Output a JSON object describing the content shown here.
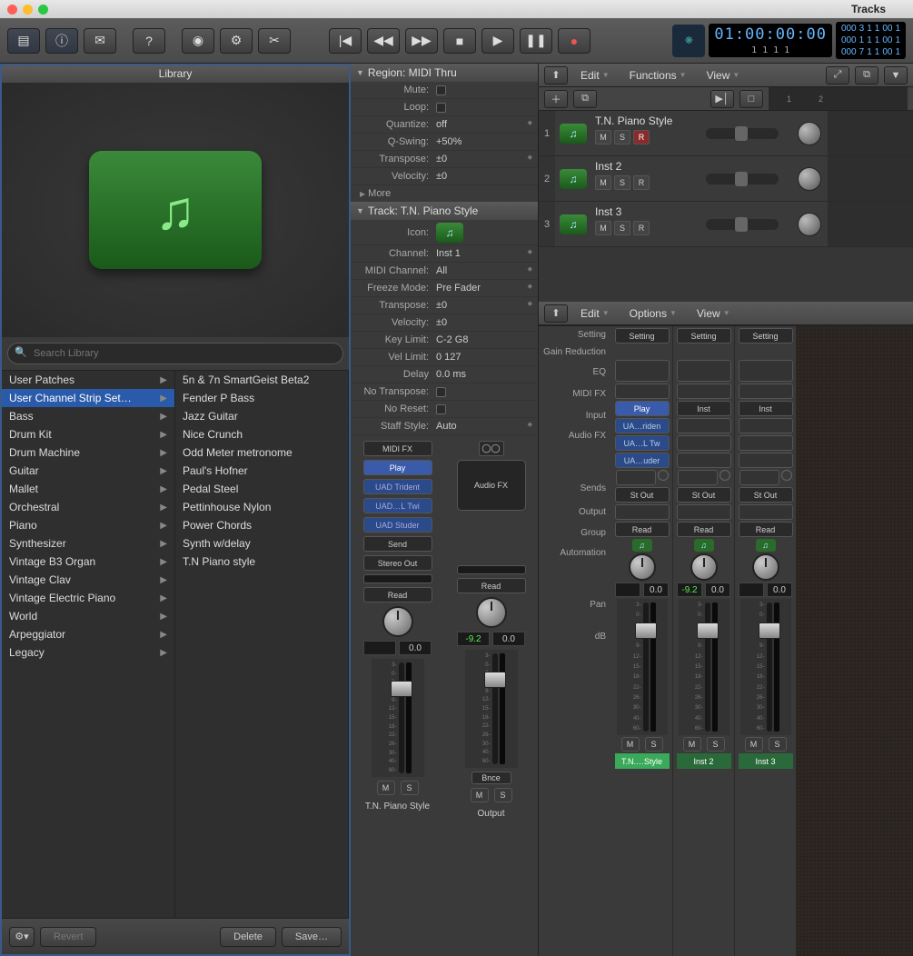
{
  "window": {
    "title": "Tracks"
  },
  "transport": {
    "timecode": "01:00:00:00",
    "timecode_sub": "1 1 1 1",
    "grid1": [
      "000",
      "3",
      "1",
      "1",
      "00",
      "1"
    ],
    "grid2": [
      "000",
      "1",
      "1",
      "1",
      "00",
      "1"
    ],
    "grid3": [
      "000",
      "7",
      "1",
      "1",
      "00",
      "1"
    ]
  },
  "library": {
    "title": "Library",
    "search_placeholder": "Search Library",
    "col1": [
      {
        "label": "User Patches",
        "sel": false
      },
      {
        "label": "User Channel Strip Set…",
        "sel": true
      },
      {
        "label": "Bass",
        "sel": false
      },
      {
        "label": "Drum Kit",
        "sel": false
      },
      {
        "label": "Drum Machine",
        "sel": false
      },
      {
        "label": "Guitar",
        "sel": false
      },
      {
        "label": "Mallet",
        "sel": false
      },
      {
        "label": "Orchestral",
        "sel": false
      },
      {
        "label": "Piano",
        "sel": false
      },
      {
        "label": "Synthesizer",
        "sel": false
      },
      {
        "label": "Vintage B3 Organ",
        "sel": false
      },
      {
        "label": "Vintage Clav",
        "sel": false
      },
      {
        "label": "Vintage Electric Piano",
        "sel": false
      },
      {
        "label": "World",
        "sel": false
      },
      {
        "label": "Arpeggiator",
        "sel": false
      },
      {
        "label": "Legacy",
        "sel": false
      }
    ],
    "col2": [
      "5n & 7n SmartGeist Beta2",
      "Fender P Bass",
      "Jazz Guitar",
      "Nice Crunch",
      "Odd Meter metronome",
      "Paul's Hofner",
      "Pedal Steel",
      "Pettinhouse Nylon",
      "Power Chords",
      "Synth w/delay",
      "T.N Piano style"
    ],
    "footer": {
      "revert": "Revert",
      "delete": "Delete",
      "save": "Save…"
    }
  },
  "inspector": {
    "region_title": "Region: MIDI Thru",
    "region": {
      "mute": "Mute:",
      "loop": "Loop:",
      "quantize": "Quantize:",
      "quantize_v": "off",
      "qswing": "Q-Swing:",
      "qswing_v": "+50%",
      "transpose": "Transpose:",
      "transpose_v": "±0",
      "velocity": "Velocity:",
      "velocity_v": "±0",
      "more": "More"
    },
    "track_title": "Track:  T.N. Piano Style",
    "track": {
      "icon": "Icon:",
      "channel": "Channel:",
      "channel_v": "Inst 1",
      "midich": "MIDI Channel:",
      "midich_v": "All",
      "freeze": "Freeze Mode:",
      "freeze_v": "Pre Fader",
      "transpose": "Transpose:",
      "transpose_v": "±0",
      "velocity": "Velocity:",
      "velocity_v": "±0",
      "keylimit": "Key Limit:",
      "keylimit_v": "C-2      G8",
      "vellimit": "Vel Limit:",
      "vellimit_v": "0     127",
      "delay": "Delay",
      "delay_v": "0.0 ms",
      "notrans": "No Transpose:",
      "noreset": "No Reset:",
      "staff": "Staff Style:",
      "staff_v": "Auto"
    },
    "strip1": {
      "midifx": "MIDI FX",
      "play": "Play",
      "fx": [
        "UAD Trident",
        "UAD…L Twi",
        "UAD Studer"
      ],
      "send": "Send",
      "out": "Stereo Out",
      "read": "Read",
      "val_l": "",
      "val_r": "0.0",
      "scale": [
        "3-",
        "0-",
        "3-",
        "6-",
        "9-",
        "12-",
        "15-",
        "18-",
        "22-",
        "26-",
        "30-",
        "40-",
        "60-"
      ],
      "m": "M",
      "s": "S",
      "name": "T.N. Piano Style"
    },
    "strip2": {
      "audiofx": "Audio FX",
      "read": "Read",
      "bnce": "Bnce",
      "val_l": "-9.2",
      "val_r": "0.0",
      "m": "M",
      "s": "S",
      "name": "Output"
    }
  },
  "tracks_bar": {
    "edit": "Edit",
    "functions": "Functions",
    "view": "View",
    "ruler": [
      "1",
      "2"
    ]
  },
  "tracks": [
    {
      "num": "1",
      "name": "T.N. Piano Style",
      "rec": true
    },
    {
      "num": "2",
      "name": "Inst 2",
      "rec": false
    },
    {
      "num": "3",
      "name": "Inst 3",
      "rec": false
    }
  ],
  "mixer_bar": {
    "edit": "Edit",
    "options": "Options",
    "view": "View"
  },
  "mixer_labels": [
    "Setting",
    "Gain Reduction",
    "EQ",
    "MIDI FX",
    "Input",
    "Audio FX",
    "",
    "",
    "Sends",
    "Output",
    "Group",
    "Automation",
    "",
    "Pan",
    "dB"
  ],
  "mixer_strips": [
    {
      "setting": "Setting",
      "input": "Play",
      "input_blue": true,
      "fx": [
        "UA…riden",
        "UA…L Tw",
        "UA…uder"
      ],
      "out": "St Out",
      "auto": "Read",
      "pan": "",
      "db_l": "",
      "db_r": "0.0",
      "m": "M",
      "s": "S",
      "name": "T.N.…Style",
      "sel": true
    },
    {
      "setting": "Setting",
      "input": "Inst",
      "input_blue": false,
      "fx": [
        "",
        "",
        ""
      ],
      "out": "St Out",
      "auto": "Read",
      "pan": "",
      "db_l": "-9.2",
      "db_r": "0.0",
      "m": "M",
      "s": "S",
      "name": "Inst 2",
      "sel": false
    },
    {
      "setting": "Setting",
      "input": "Inst",
      "input_blue": false,
      "fx": [
        "",
        "",
        ""
      ],
      "out": "St Out",
      "auto": "Read",
      "pan": "",
      "db_l": "",
      "db_r": "0.0",
      "m": "M",
      "s": "S",
      "name": "Inst 3",
      "sel": false
    }
  ]
}
